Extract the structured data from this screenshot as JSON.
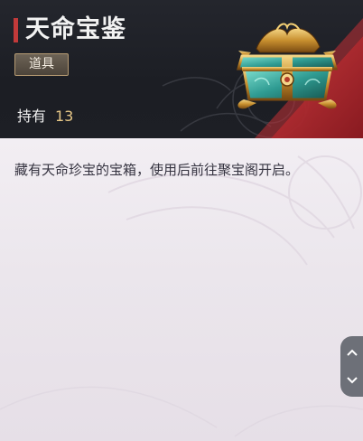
{
  "item": {
    "name": "天命宝鉴",
    "type": "道具",
    "owned_label": "持有",
    "owned_count": "13",
    "description": "藏有天命珍宝的宝箱，使用后前往聚宝阁开启。",
    "icon": "treasure-chest-icon"
  },
  "colors": {
    "header_bg": "#1f2127",
    "title_accent": "#c23a3a",
    "red_stripe": "#b8262c",
    "count_gold": "#e8c887",
    "body_bg": "#ebe6ec",
    "text_dark": "#353340"
  },
  "scroll": {
    "up_icon": "chevron-up-icon",
    "down_icon": "chevron-down-icon"
  }
}
